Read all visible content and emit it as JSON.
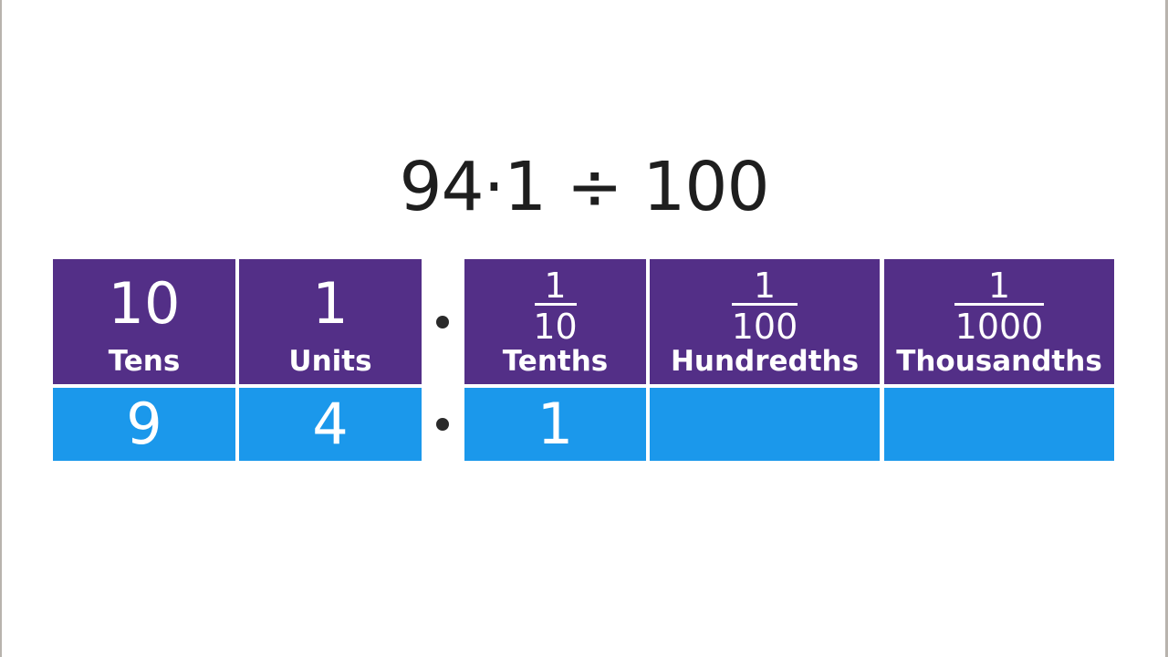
{
  "title": "94·1 ÷ 100",
  "columns": [
    {
      "name": "tens",
      "value_label": "10",
      "label": "Tens",
      "digit": "9",
      "is_fraction": false
    },
    {
      "name": "units",
      "value_label": "1",
      "label": "Units",
      "digit": "4",
      "is_fraction": false
    },
    {
      "name": "tenths",
      "numerator": "1",
      "denominator": "10",
      "label": "Tenths",
      "digit": "1",
      "is_fraction": true
    },
    {
      "name": "hundredths",
      "numerator": "1",
      "denominator": "100",
      "label": "Hundredths",
      "digit": "",
      "is_fraction": true
    },
    {
      "name": "thousandths",
      "numerator": "1",
      "denominator": "1000",
      "label": "Thousandths",
      "digit": "",
      "is_fraction": true
    }
  ],
  "decimal_point_symbol": "•",
  "colors": {
    "header_bg": "#532f87",
    "value_bg": "#1b98eb",
    "text": "#ffffff",
    "title_text": "#1e1e1e"
  }
}
